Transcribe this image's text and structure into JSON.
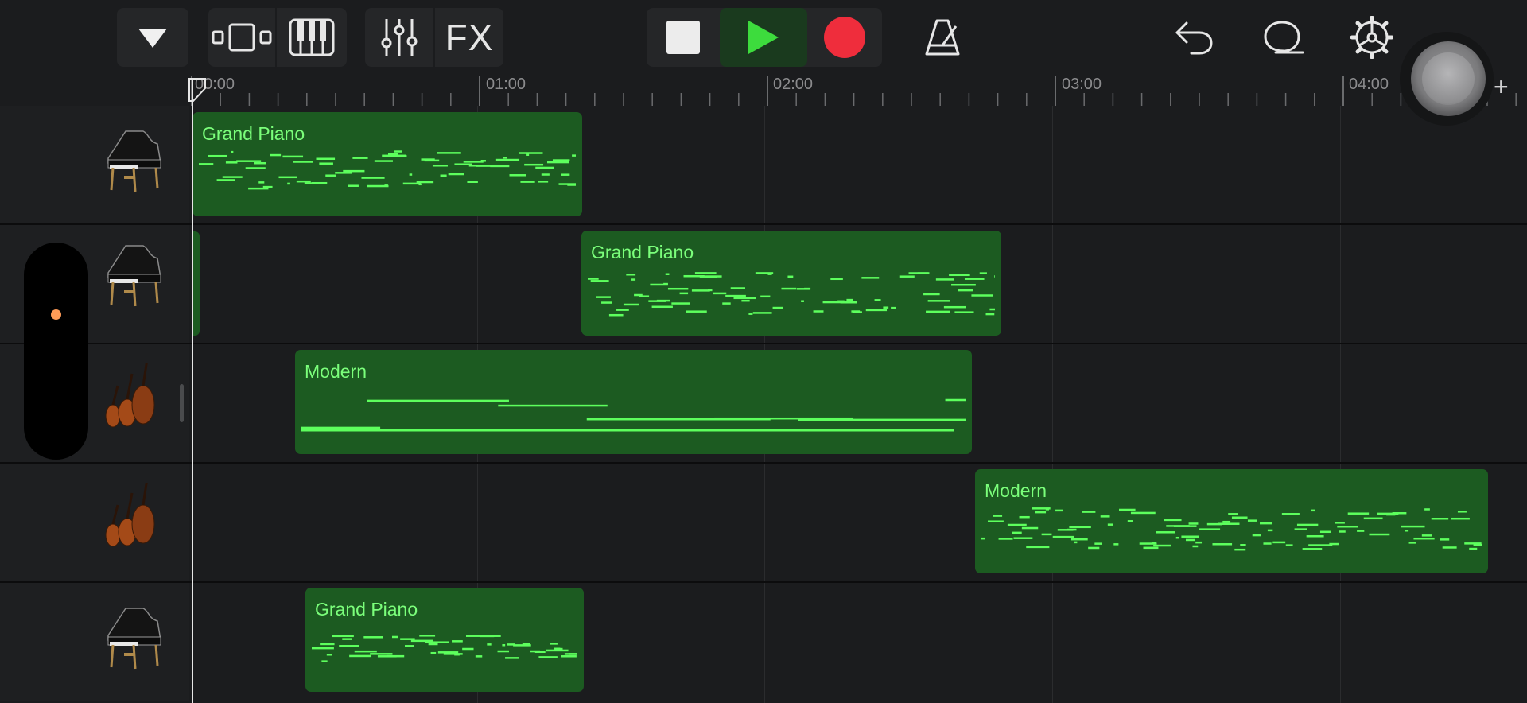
{
  "toolbar": {
    "fx_label": "FX"
  },
  "ruler": {
    "labels": [
      "00:00",
      "01:00",
      "02:00",
      "03:00",
      "04:00"
    ]
  },
  "tracks": [
    {
      "instrument": "grand-piano",
      "regions": [
        {
          "name": "Grand Piano"
        }
      ]
    },
    {
      "instrument": "grand-piano",
      "regions": [
        {
          "name": "Grand Piano"
        }
      ]
    },
    {
      "instrument": "strings",
      "regions": [
        {
          "name": "Modern"
        }
      ]
    },
    {
      "instrument": "strings",
      "regions": [
        {
          "name": "Modern"
        }
      ]
    },
    {
      "instrument": "grand-piano",
      "regions": [
        {
          "name": "Grand Piano"
        }
      ]
    }
  ],
  "add_track_label": "+",
  "colors": {
    "region_fill": "#1c5b21",
    "region_notes": "#5dff5d",
    "record": "#ef2d3c",
    "play": "#3ddc3d",
    "selected_dot": "#ff9b57"
  }
}
